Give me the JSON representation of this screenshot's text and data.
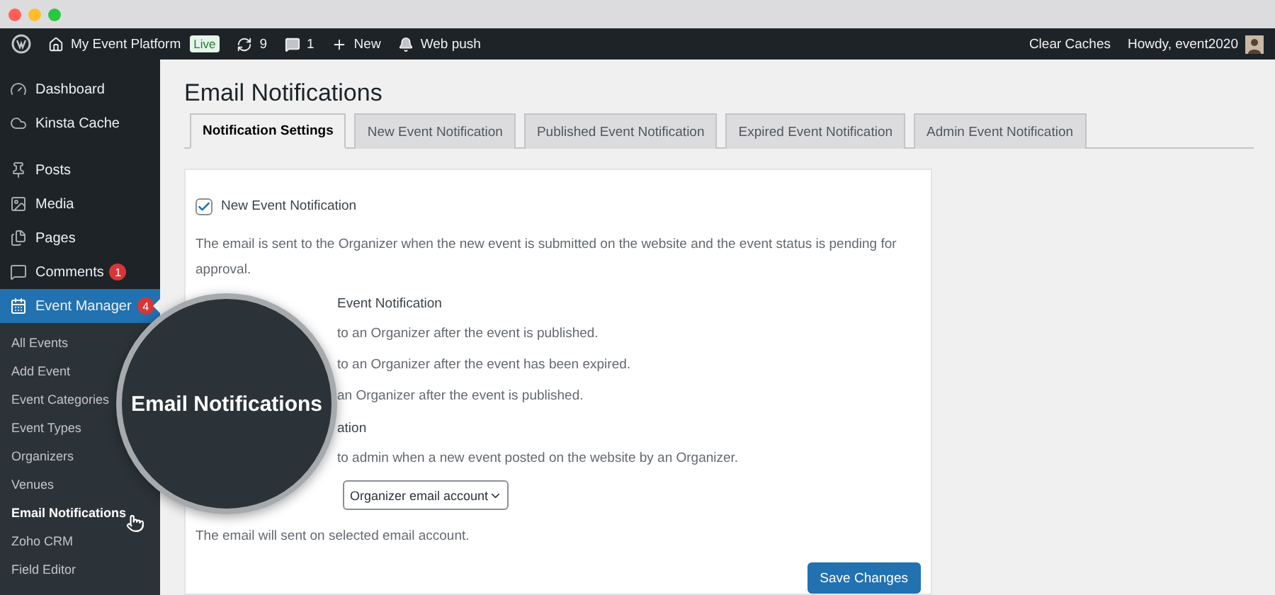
{
  "admin_bar": {
    "site": "My Event Platform",
    "live_badge": "Live",
    "updates": "9",
    "comments": "1",
    "new": "New",
    "web_push": "Web push",
    "clear_caches": "Clear Caches",
    "greeting": "Howdy, event2020"
  },
  "sidebar": {
    "items": [
      {
        "label": "Dashboard",
        "selected": false
      },
      {
        "label": "Kinsta Cache",
        "selected": false
      },
      {
        "label": "Posts",
        "selected": false
      },
      {
        "label": "Media",
        "selected": false
      },
      {
        "label": "Pages",
        "selected": false
      },
      {
        "label": "Comments",
        "selected": false,
        "badge": "1"
      },
      {
        "label": "Event Manager",
        "selected": true,
        "badge": "4"
      }
    ],
    "submenu": [
      {
        "label": "All Events",
        "selected": false
      },
      {
        "label": "Add Event",
        "selected": false
      },
      {
        "label": "Event Categories",
        "selected": false
      },
      {
        "label": "Event Types",
        "selected": false
      },
      {
        "label": "Organizers",
        "selected": false
      },
      {
        "label": "Venues",
        "selected": false
      },
      {
        "label": "Email Notifications",
        "selected": true
      },
      {
        "label": "Zoho CRM",
        "selected": false
      },
      {
        "label": "Field Editor",
        "selected": false
      }
    ]
  },
  "page_title": "Email Notifications",
  "tabs": [
    {
      "label": "Notification Settings",
      "selected": true
    },
    {
      "label": "New Event Notification",
      "selected": false
    },
    {
      "label": "Published Event Notification",
      "selected": false
    },
    {
      "label": "Expired Event Notification",
      "selected": false
    },
    {
      "label": "Admin Event Notification",
      "selected": false
    }
  ],
  "settings": [
    {
      "kind": "checkbox",
      "label": "New Event Notification",
      "checked": true
    },
    {
      "kind": "text",
      "text": "The email is sent to the Organizer when the new event is submitted on the website and the event status is pending for approval."
    },
    {
      "kind": "partial-heading",
      "text": "Event Notification"
    },
    {
      "kind": "partial",
      "text": "to an Organizer after the event is published."
    },
    {
      "kind": "partial",
      "text": "to an Organizer after the event has been expired."
    },
    {
      "kind": "partial",
      "text": "an Organizer after the event is published."
    },
    {
      "kind": "partial-heading",
      "text": "ation"
    },
    {
      "kind": "partial",
      "text": "to admin when a new event posted on the website by an Organizer."
    },
    {
      "kind": "select",
      "value": "Organizer email account"
    },
    {
      "kind": "text",
      "text": "The email will sent on selected email account."
    }
  ],
  "save_button": "Save Changes",
  "magnifier": {
    "text": "Email Notifications"
  }
}
